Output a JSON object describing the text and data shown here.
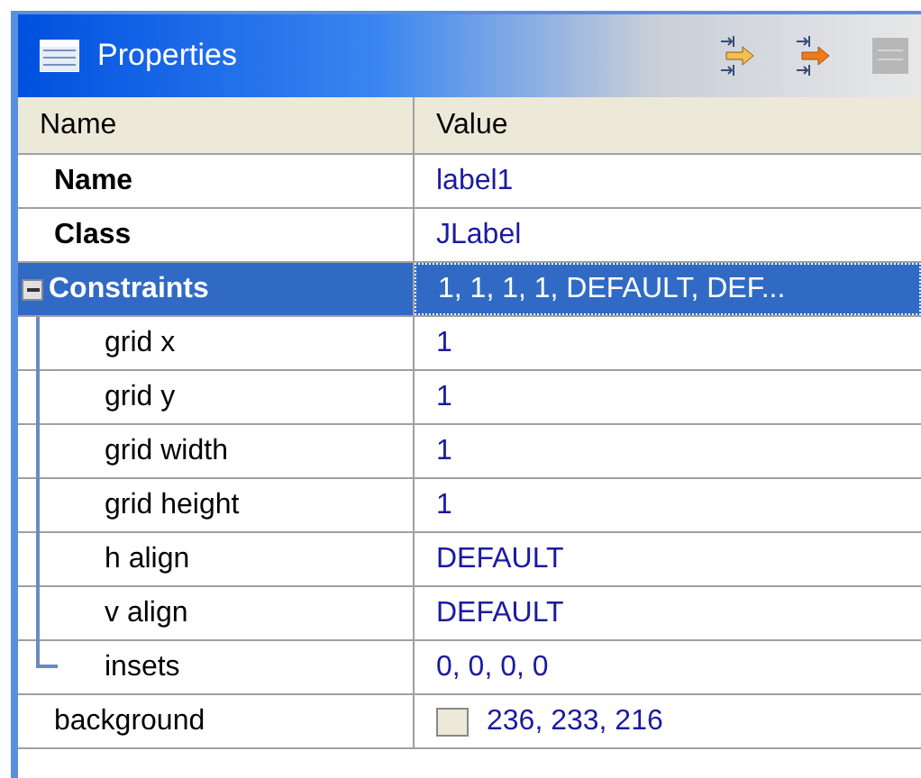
{
  "panel": {
    "title": "Properties"
  },
  "toolbar": [
    {
      "kind": "arrow-pale",
      "disabled": false
    },
    {
      "kind": "arrow-orange",
      "disabled": false
    },
    {
      "kind": "sheet",
      "disabled": true
    }
  ],
  "columns": [
    "Name",
    "Value"
  ],
  "rows": [
    {
      "name": "Name",
      "value": "label1",
      "bold": true,
      "selected": false
    },
    {
      "name": "Class",
      "value": "JLabel",
      "bold": true,
      "selected": false
    },
    {
      "name": "Constraints",
      "value": "1, 1, 1, 1, DEFAULT, DEF...",
      "bold": true,
      "selected": true,
      "expanded": true,
      "children": [
        {
          "name": "grid x",
          "value": "1",
          "bold": false,
          "selected": false
        },
        {
          "name": "grid y",
          "value": "1",
          "bold": false,
          "selected": false
        },
        {
          "name": "grid width",
          "value": "1",
          "bold": false,
          "selected": false
        },
        {
          "name": "grid height",
          "value": "1",
          "bold": false,
          "selected": false
        },
        {
          "name": "h align",
          "value": "DEFAULT",
          "bold": false,
          "selected": false
        },
        {
          "name": "v align",
          "value": "DEFAULT",
          "bold": false,
          "selected": false
        },
        {
          "name": "insets",
          "value": "0, 0, 0, 0",
          "bold": false,
          "selected": false
        }
      ]
    },
    {
      "name": "background",
      "value": "236, 233, 216",
      "bold": false,
      "selected": false,
      "color": "#ece9d8"
    }
  ]
}
